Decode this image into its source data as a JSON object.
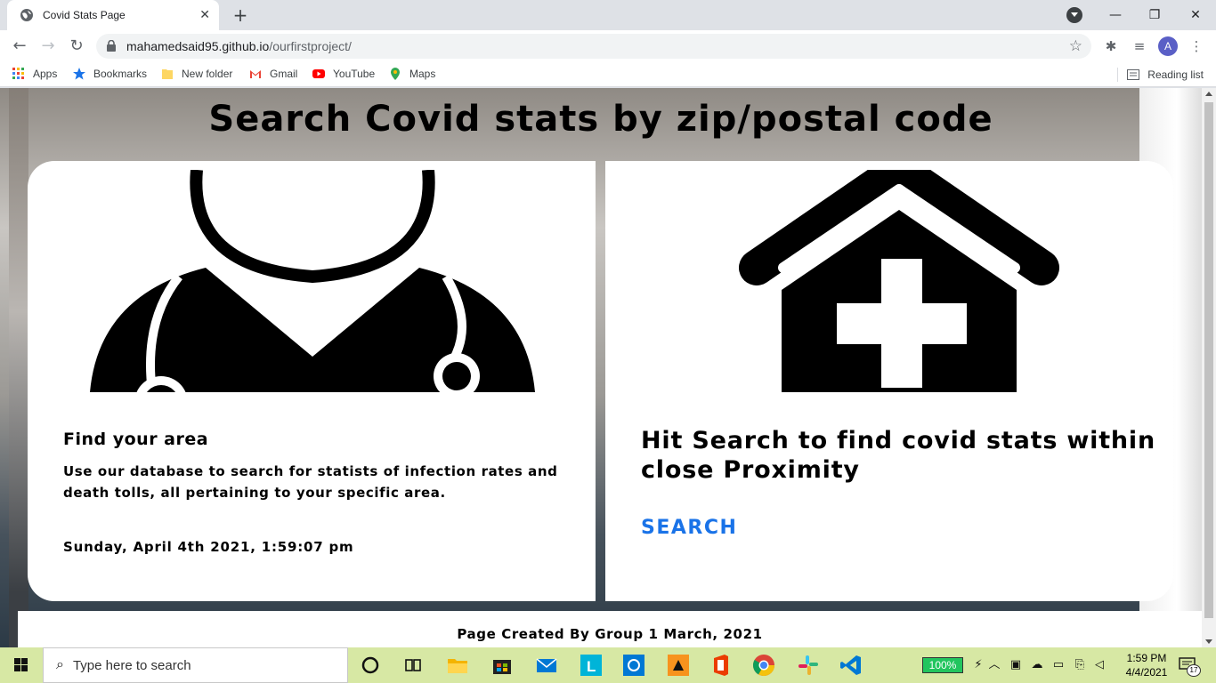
{
  "browser": {
    "tab_title": "Covid Stats Page",
    "url_host": "mahamedsaid95.github.io",
    "url_path": "/ourfirstproject/",
    "avatar_letter": "A",
    "bookmarks": [
      {
        "label": "Apps",
        "icon": "apps-grid-icon"
      },
      {
        "label": "Bookmarks",
        "icon": "star-icon"
      },
      {
        "label": "New folder",
        "icon": "folder-icon"
      },
      {
        "label": "Gmail",
        "icon": "gmail-icon"
      },
      {
        "label": "YouTube",
        "icon": "youtube-icon"
      },
      {
        "label": "Maps",
        "icon": "maps-pin-icon"
      }
    ],
    "reading_list": "Reading list"
  },
  "page": {
    "heading": "Search Covid stats by zip/postal code",
    "left_card": {
      "image": "doctor-stethoscope-icon",
      "title": "Find your area",
      "text": "Use our database to search for statists of infection rates and death tolls, all pertaining to your specific area.",
      "datetime": "Sunday, April 4th 2021, 1:59:07 pm"
    },
    "right_card": {
      "image": "hospital-house-cross-icon",
      "title": "Hit Search to find covid stats within close Proximity",
      "search_label": "SEARCH"
    },
    "footer": "Page Created By Group 1 March, 2021"
  },
  "taskbar": {
    "search_placeholder": "Type here to search",
    "battery": "100%",
    "time": "1:59 PM",
    "date": "4/4/2021",
    "notifications": "17"
  },
  "colors": {
    "accent": "#1a73e8",
    "taskbar": "#d7e8a4",
    "battery": "#22c55e"
  }
}
